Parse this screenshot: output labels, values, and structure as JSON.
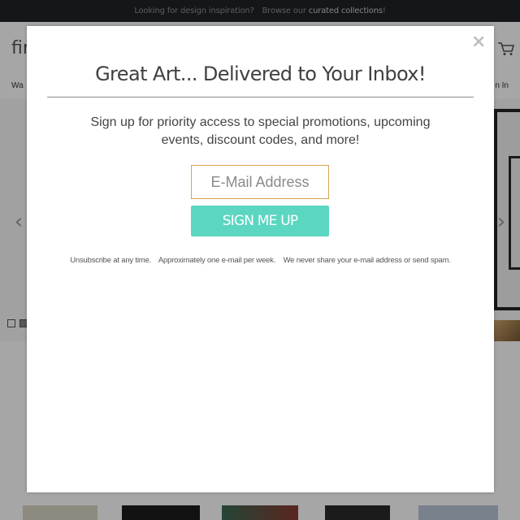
{
  "promo_bar": {
    "text": "Looking for design inspiration?",
    "browse_text": "Browse our",
    "link_text": "curated collections",
    "suffix": "!"
  },
  "header": {
    "logo_fragment": "fir",
    "nav_fragment": "Wa",
    "signin_fragment": "n In",
    "cart_icon": "cart-icon"
  },
  "carousel": {
    "prev_icon": "chevron-left-icon",
    "next_icon": "chevron-right-icon"
  },
  "modal": {
    "close_label": "×",
    "title": "Great Art... Delivered to Your Inbox!",
    "subtitle": "Sign up for priority access to special promotions, upcoming events, discount codes, and more!",
    "email_placeholder": "E-Mail Address",
    "submit_label": "SIGN ME UP",
    "disclaimer": [
      "Unsubscribe at any time.",
      "Approximately one e-mail per week.",
      "We never share your e-mail address or send spam."
    ]
  },
  "colors": {
    "promo_bg": "#1f2227",
    "button_bg": "#5bd6c1",
    "field_border": "#d8a652",
    "overlay": "rgba(0,0,0,0.35)"
  }
}
